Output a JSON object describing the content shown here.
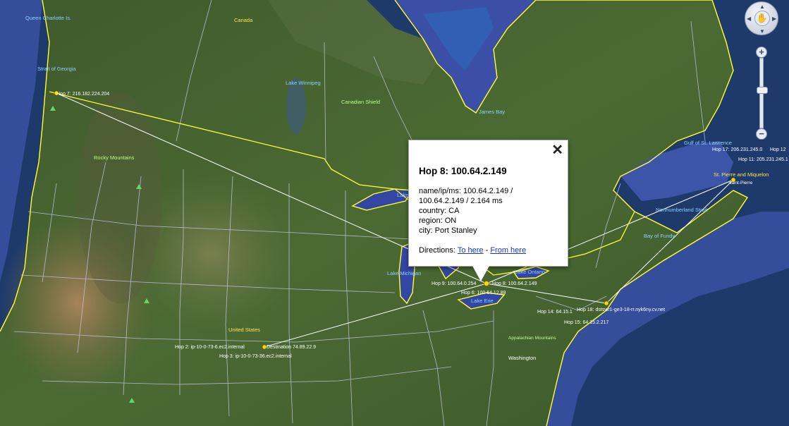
{
  "map": {
    "labels": {
      "canada": "Canada",
      "lake_winnipeg": "Lake Winnipeg",
      "canadian_shield": "Canadian Shield",
      "james_bay": "James Bay",
      "rocky_mountains": "Rocky Mountains",
      "queen_charlotte": "Queen Charlotte Is.",
      "strait_of_georgia": "Strait of Georgia",
      "lake_michigan": "Lake Michigan",
      "lake_ontario": "Lake Ontario",
      "lake_erie": "Lake Erie",
      "lake_superior": "Lake",
      "united_states": "United States",
      "appalachian": "Appalachian Mountains",
      "washington": "Washington",
      "gulf_st_lawrence": "Gulf of St. Lawrence",
      "st_pierre": "St. Pierre and Miquelon",
      "saint_pierre": "Saint-Pierre",
      "northumberland": "Northumberland Strait",
      "bay_of_fundy": "Bay of Fundy"
    },
    "hops": {
      "hop7": "Hop 7: 216.182.224.204",
      "hop2": "Hop 2: ip-10-0-73-6.ec2.internal",
      "destination": "Destination 74.89.22.9",
      "hop3": "Hop 3: ip-10-0-73-36.ec2.internal",
      "hop9": "Hop 9: 100.64.0.254",
      "hop8": "Hop 8: 100.64.2.149",
      "hop6": "Hop 6: 100.64.12.89",
      "hop14": "Hop 14: 64.15.1",
      "hop18": "Hop 18: dstswr1-ge3-18-rr.nyk6ny.cv.net",
      "hop15": "Hop 15: 64.15.2.217",
      "hop17": "Hop 17: 206.231.245.0",
      "hop12": "Hop 12",
      "hop11": "Hop 11: 205.231.245.1"
    }
  },
  "popup": {
    "title": "Hop 8: 100.64.2.149",
    "name_line1": "name/ip/ms: 100.64.2.149 /",
    "name_line2": "100.64.2.149 / 2.164 ms",
    "country": "country: CA",
    "region": "region: ON",
    "city": "city: Port Stanley",
    "directions_label": "Directions:",
    "to_here": "To here",
    "separator": "-",
    "from_here": "From here",
    "close_glyph": "✕"
  },
  "controls": {
    "zoom_in": "+",
    "zoom_out": "−",
    "zoom_mid": "−",
    "pan_glyph": "✋"
  },
  "colors": {
    "route_line": "#ffffff",
    "border_yellow": "#ffff33",
    "state_lines": "#c9c7e8",
    "ocean": "#1f3b6e"
  }
}
